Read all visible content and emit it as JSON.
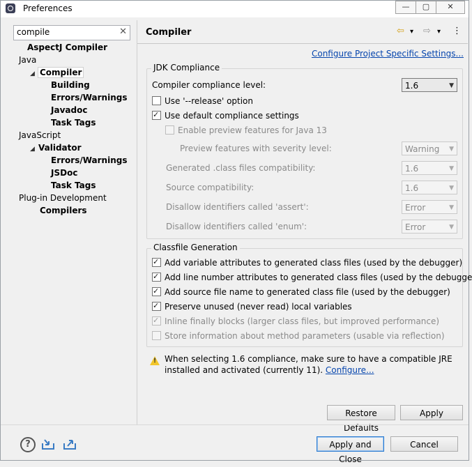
{
  "window": {
    "title": "Preferences",
    "controls": {
      "minimize": "—",
      "restore": "▢",
      "close": "✕"
    }
  },
  "search": {
    "value": "compile",
    "clear": "✕"
  },
  "tree": [
    {
      "label": "AspectJ Compiler",
      "bold": true
    },
    {
      "label": "Java",
      "bold": false
    },
    {
      "label": "Compiler",
      "bold": true,
      "selected": true
    },
    {
      "label": "Building",
      "bold": true
    },
    {
      "label": "Errors/Warnings",
      "bold": true
    },
    {
      "label": "Javadoc",
      "bold": true
    },
    {
      "label": "Task Tags",
      "bold": true
    },
    {
      "label": "JavaScript",
      "bold": false
    },
    {
      "label": "Validator",
      "bold": true
    },
    {
      "label": "Errors/Warnings",
      "bold": true
    },
    {
      "label": "JSDoc",
      "bold": true
    },
    {
      "label": "Task Tags",
      "bold": true
    },
    {
      "label": "Plug-in Development",
      "bold": false
    },
    {
      "label": "Compilers",
      "bold": true
    }
  ],
  "page": {
    "title": "Compiler",
    "configure_link": "Configure Project Specific Settings...",
    "nav": {
      "back": "⇦",
      "back_menu": "▾",
      "forward": "⇨",
      "forward_menu": "▾",
      "more": "⋮"
    }
  },
  "jdk": {
    "group_title": "JDK Compliance",
    "level_label": "Compiler compliance level:",
    "level_value": "1.6",
    "release_label": "Use '--release' option",
    "release_checked": false,
    "default_label": "Use default compliance settings",
    "default_checked": true,
    "preview_label": "Enable preview features for Java 13",
    "preview_checked": false,
    "rows": [
      {
        "label": "Preview features with severity level:",
        "value": "Warning"
      },
      {
        "label": "Generated .class files compatibility:",
        "value": "1.6"
      },
      {
        "label": "Source compatibility:",
        "value": "1.6"
      },
      {
        "label": "Disallow identifiers called 'assert':",
        "value": "Error"
      },
      {
        "label": "Disallow identifiers called 'enum':",
        "value": "Error"
      }
    ]
  },
  "classfile": {
    "group_title": "Classfile Generation",
    "options": [
      {
        "label": "Add variable attributes to generated class files (used by the debugger)",
        "checked": true,
        "enabled": true
      },
      {
        "label": "Add line number attributes to generated class files (used by the debugger)",
        "checked": true,
        "enabled": true
      },
      {
        "label": "Add source file name to generated class file (used by the debugger)",
        "checked": true,
        "enabled": true
      },
      {
        "label": "Preserve unused (never read) local variables",
        "checked": true,
        "enabled": true
      },
      {
        "label": "Inline finally blocks (larger class files, but improved performance)",
        "checked": true,
        "enabled": false
      },
      {
        "label": "Store information about method parameters (usable via reflection)",
        "checked": false,
        "enabled": false
      }
    ]
  },
  "warning": {
    "text": "When selecting 1.6 compliance, make sure to have a compatible JRE installed and activated (currently 11).",
    "link": "Configure..."
  },
  "buttons": {
    "restore_defaults": "Restore Defaults",
    "apply": "Apply",
    "apply_close": "Apply and Close",
    "cancel": "Cancel"
  },
  "footer": {
    "help": "?"
  },
  "colors": {
    "link": "#0645ad",
    "warning": "#f2c62b",
    "default_button_border": "#2b7bd0"
  }
}
